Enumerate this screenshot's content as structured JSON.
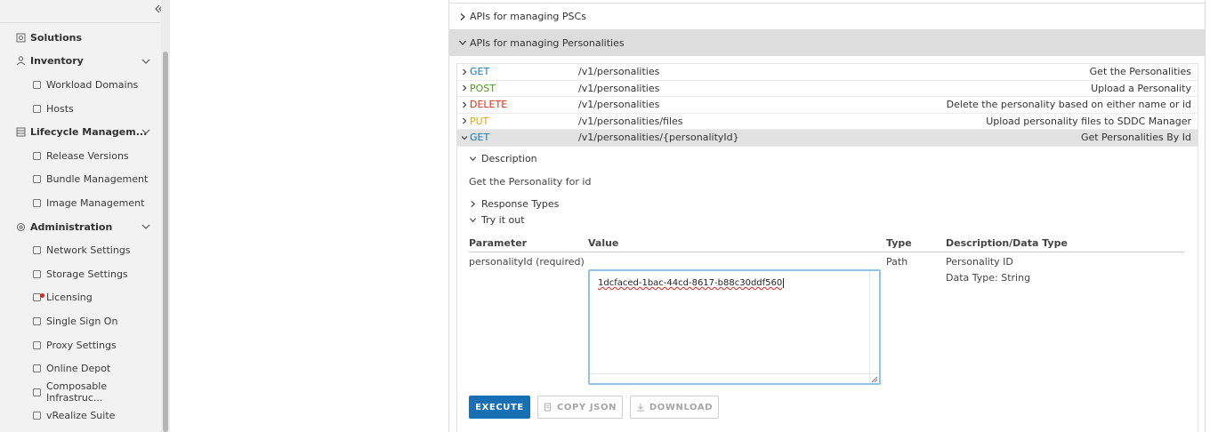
{
  "sidebar": {
    "items": [
      {
        "label": "Solutions",
        "level": "top",
        "icon": "solutions-icon"
      },
      {
        "label": "Inventory",
        "level": "top",
        "icon": "inventory-icon",
        "expanded": true
      },
      {
        "label": "Workload Domains",
        "level": "sub",
        "icon": "workload-domains-icon"
      },
      {
        "label": "Hosts",
        "level": "sub",
        "icon": "hosts-icon"
      },
      {
        "label": "Lifecycle Managem...",
        "level": "top",
        "icon": "lifecycle-icon",
        "expanded": true
      },
      {
        "label": "Release Versions",
        "level": "sub",
        "icon": "release-versions-icon"
      },
      {
        "label": "Bundle Management",
        "level": "sub",
        "icon": "bundle-icon"
      },
      {
        "label": "Image Management",
        "level": "sub",
        "icon": "image-management-icon"
      },
      {
        "label": "Administration",
        "level": "top",
        "icon": "administration-icon",
        "expanded": true
      },
      {
        "label": "Network Settings",
        "level": "sub",
        "icon": "network-settings-icon"
      },
      {
        "label": "Storage Settings",
        "level": "sub",
        "icon": "storage-settings-icon"
      },
      {
        "label": "Licensing",
        "level": "sub",
        "icon": "licensing-icon",
        "badge": true
      },
      {
        "label": "Single Sign On",
        "level": "sub",
        "icon": "sso-icon"
      },
      {
        "label": "Proxy Settings",
        "level": "sub",
        "icon": "proxy-settings-icon"
      },
      {
        "label": "Online Depot",
        "level": "sub",
        "icon": "online-depot-icon"
      },
      {
        "label": "Composable Infrastruc...",
        "level": "sub",
        "icon": "composable-icon"
      },
      {
        "label": "vRealize Suite",
        "level": "sub",
        "icon": "vrealize-icon"
      }
    ]
  },
  "groups": [
    {
      "label": "APIs for managing PSCs",
      "expanded": false
    },
    {
      "label": "APIs for managing Personalities",
      "expanded": true
    }
  ],
  "operations": [
    {
      "method": "GET",
      "path": "/v1/personalities",
      "summary": "Get the Personalities",
      "color": "#1a7ab8"
    },
    {
      "method": "POST",
      "path": "/v1/personalities",
      "summary": "Upload a Personality",
      "color": "#4f9a1e"
    },
    {
      "method": "DELETE",
      "path": "/v1/personalities",
      "summary": "Delete the personality based on either name or id",
      "color": "#d4301a"
    },
    {
      "method": "PUT",
      "path": "/v1/personalities/files",
      "summary": "Upload personality files to SDDC Manager",
      "color": "#e8a40a"
    },
    {
      "method": "GET",
      "path": "/v1/personalities/{personalityId}",
      "summary": "Get Personalities By Id",
      "color": "#1a7ab8",
      "active": true
    }
  ],
  "detail": {
    "description_title": "Description",
    "description_text": "Get the Personality for id",
    "response_types_title": "Response Types",
    "try_it_out_title": "Try it out",
    "columns": {
      "parameter": "Parameter",
      "value": "Value",
      "type": "Type",
      "description": "Description/Data Type"
    },
    "param": {
      "name": "personalityId (required)",
      "value": "1dcfaced-1bac-44cd-8617-b88c30ddf560",
      "type": "Path",
      "description": "Personality ID",
      "data_type": "Data Type: String"
    },
    "buttons": {
      "execute": "EXECUTE",
      "copy_json": "COPY JSON",
      "download": "DOWNLOAD"
    }
  },
  "colors": {
    "accent": "#1670b3",
    "active_row": "#e2e2e2",
    "group_expanded": "#dddddd"
  }
}
